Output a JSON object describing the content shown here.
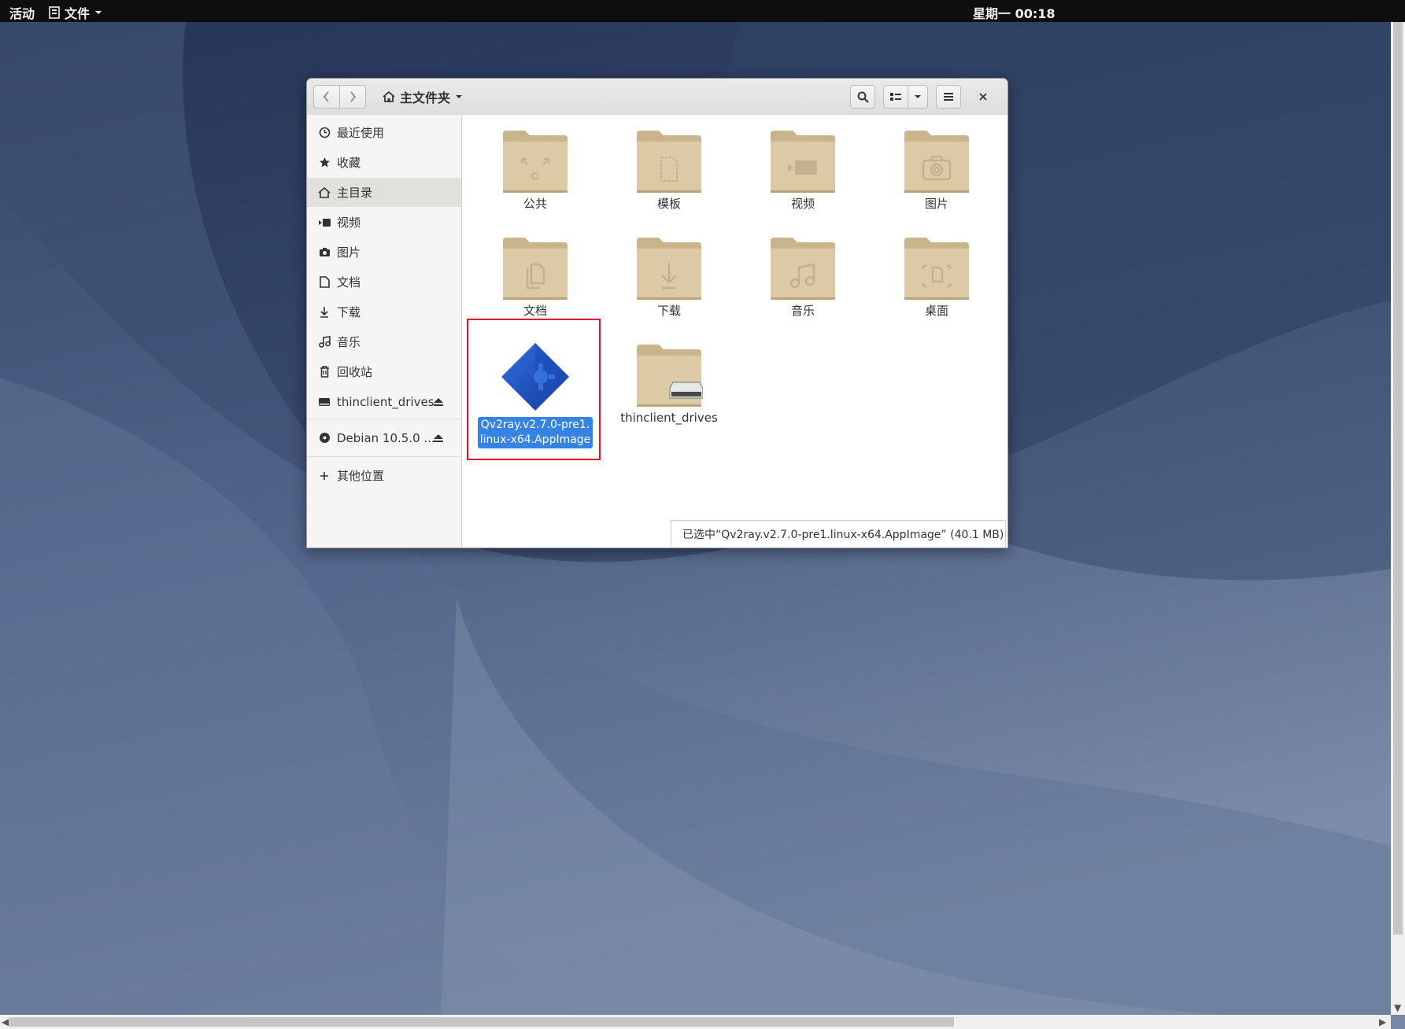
{
  "topbar": {
    "activities": "活动",
    "app_menu": "文件",
    "clock": "星期一 00:18"
  },
  "window": {
    "path_label": "主文件夹",
    "sidebar": {
      "items": [
        {
          "label": "最近使用",
          "icon": "clock-icon"
        },
        {
          "label": "收藏",
          "icon": "star-icon"
        },
        {
          "label": "主目录",
          "icon": "home-icon"
        },
        {
          "label": "视频",
          "icon": "video-icon"
        },
        {
          "label": "图片",
          "icon": "camera-icon"
        },
        {
          "label": "文档",
          "icon": "document-icon"
        },
        {
          "label": "下载",
          "icon": "download-icon"
        },
        {
          "label": "音乐",
          "icon": "music-icon"
        },
        {
          "label": "回收站",
          "icon": "trash-icon"
        },
        {
          "label": "thinclient_drives",
          "icon": "drive-icon"
        },
        {
          "label": "Debian 10.5.0 ...",
          "icon": "disc-icon"
        },
        {
          "label": "其他位置",
          "icon": "plus-icon"
        }
      ]
    },
    "files": [
      {
        "label": "公共",
        "emblem": "share-icon"
      },
      {
        "label": "模板",
        "emblem": "template-icon"
      },
      {
        "label": "视频",
        "emblem": "video-icon"
      },
      {
        "label": "图片",
        "emblem": "camera-icon"
      },
      {
        "label": "文档",
        "emblem": "document-icon"
      },
      {
        "label": "下载",
        "emblem": "download-icon"
      },
      {
        "label": "音乐",
        "emblem": "music-icon"
      },
      {
        "label": "桌面",
        "emblem": "desktop-icon"
      },
      {
        "label_line1": "Qv2ray.v2.7.0-pre1.",
        "label_line2": "linux-x64.AppImage",
        "icon": "appimage-icon"
      },
      {
        "label": "thinclient_drives",
        "emblem": "drive-icon"
      }
    ],
    "status": "已选中“Qv2ray.v2.7.0-pre1.linux-x64.AppImage” (40.1 MB)"
  },
  "colors": {
    "folder": "#dcc9a6",
    "folder_tab": "#c9b48c",
    "selection": "#3584e4",
    "highlight_box": "#e01b24"
  }
}
